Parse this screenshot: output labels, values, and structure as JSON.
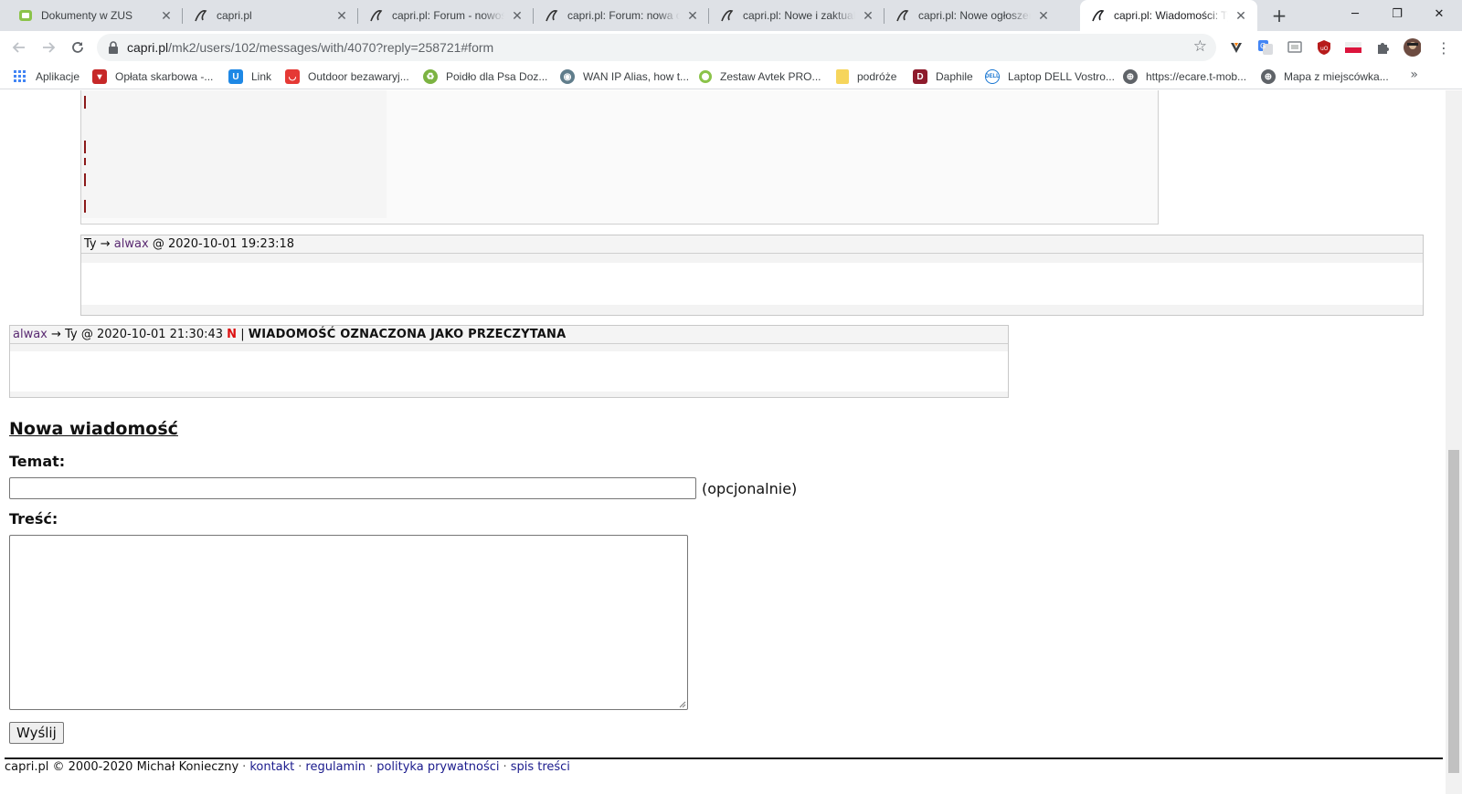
{
  "browser": {
    "tabs": [
      {
        "title": "Dokumenty w ZUS",
        "icon": "zus-icon",
        "active": false
      },
      {
        "title": "capri.pl",
        "icon": "capri-icon",
        "active": false
      },
      {
        "title": "capri.pl: Forum - nowości",
        "icon": "capri-icon",
        "active": false
      },
      {
        "title": "capri.pl: Forum: nowa od",
        "icon": "capri-icon",
        "active": false
      },
      {
        "title": "capri.pl: Nowe i zaktualiz",
        "icon": "capri-icon",
        "active": false
      },
      {
        "title": "capri.pl: Nowe ogłoszeni",
        "icon": "capri-icon",
        "active": false
      },
      {
        "title": "capri.pl: Wiadomości: Ty",
        "icon": "capri-icon",
        "active": true
      }
    ],
    "new_tab": "+",
    "window": {
      "minimize": "─",
      "restore": "❐",
      "close": "✕"
    },
    "url_host": "capri.pl",
    "url_path": "/mk2/users/102/messages/with/4070?reply=258721#form",
    "bookmarks": [
      {
        "label": "Aplikacje",
        "icon": "apps-grid-icon",
        "color": "#4285f4"
      },
      {
        "label": "Opłata skarbowa -...",
        "icon": "coat-of-arms-icon",
        "color": "#c62828"
      },
      {
        "label": "Link",
        "icon": "link-u-icon",
        "color": "#1e88e5"
      },
      {
        "label": "Outdoor bezawaryj...",
        "icon": "shop-icon",
        "color": "#e53935"
      },
      {
        "label": "Poidło dla Psa Doz...",
        "icon": "shop-green-icon",
        "color": "#7cb342"
      },
      {
        "label": "WAN IP Alias, how t...",
        "icon": "forum-icon",
        "color": "#607d8b"
      },
      {
        "label": "Zestaw Avtek PRO...",
        "icon": "circle-green-icon",
        "color": "#8bc34a"
      },
      {
        "label": "podróże",
        "icon": "folder-icon",
        "color": "#f6d55c"
      },
      {
        "label": "Daphile",
        "icon": "daphile-icon",
        "color": "#8e1b2c"
      },
      {
        "label": "Laptop DELL Vostro...",
        "icon": "dell-icon",
        "color": "#1976d2"
      },
      {
        "label": "https://ecare.t-mob...",
        "icon": "globe-icon",
        "color": "#5f6368"
      },
      {
        "label": "Mapa z miejscówka...",
        "icon": "globe-icon",
        "color": "#5f6368"
      }
    ],
    "bookmarks_more": "»"
  },
  "thread": {
    "messages": [
      {
        "sender": "Ty",
        "arrow": "→",
        "recipient": "alwax",
        "at": "@",
        "timestamp": "2020-10-01 19:23:18"
      },
      {
        "sender": "alwax",
        "arrow": "→",
        "recipient": "Ty",
        "at": "@",
        "timestamp": "2020-10-01 21:30:43",
        "new_flag": "N",
        "separator": "|",
        "status": "WIADOMOŚĆ OZNACZONA JAKO PRZECZYTANA"
      }
    ]
  },
  "form": {
    "heading": "Nowa wiadomość",
    "subject_label": "Temat:",
    "subject_value": "",
    "subject_note": "(opcjonalnie)",
    "body_label": "Treść:",
    "body_value": "",
    "submit": "Wyślij"
  },
  "footer": {
    "copyright": "capri.pl © 2000-2020 Michał Konieczny",
    "sep": "·",
    "links": [
      "kontakt",
      "regulamin",
      "polityka prywatności",
      "spis treści"
    ]
  },
  "colors": {
    "user_link": "#5a2a72",
    "new_flag": "#dd1111",
    "footer_link": "#1a1a8c"
  }
}
